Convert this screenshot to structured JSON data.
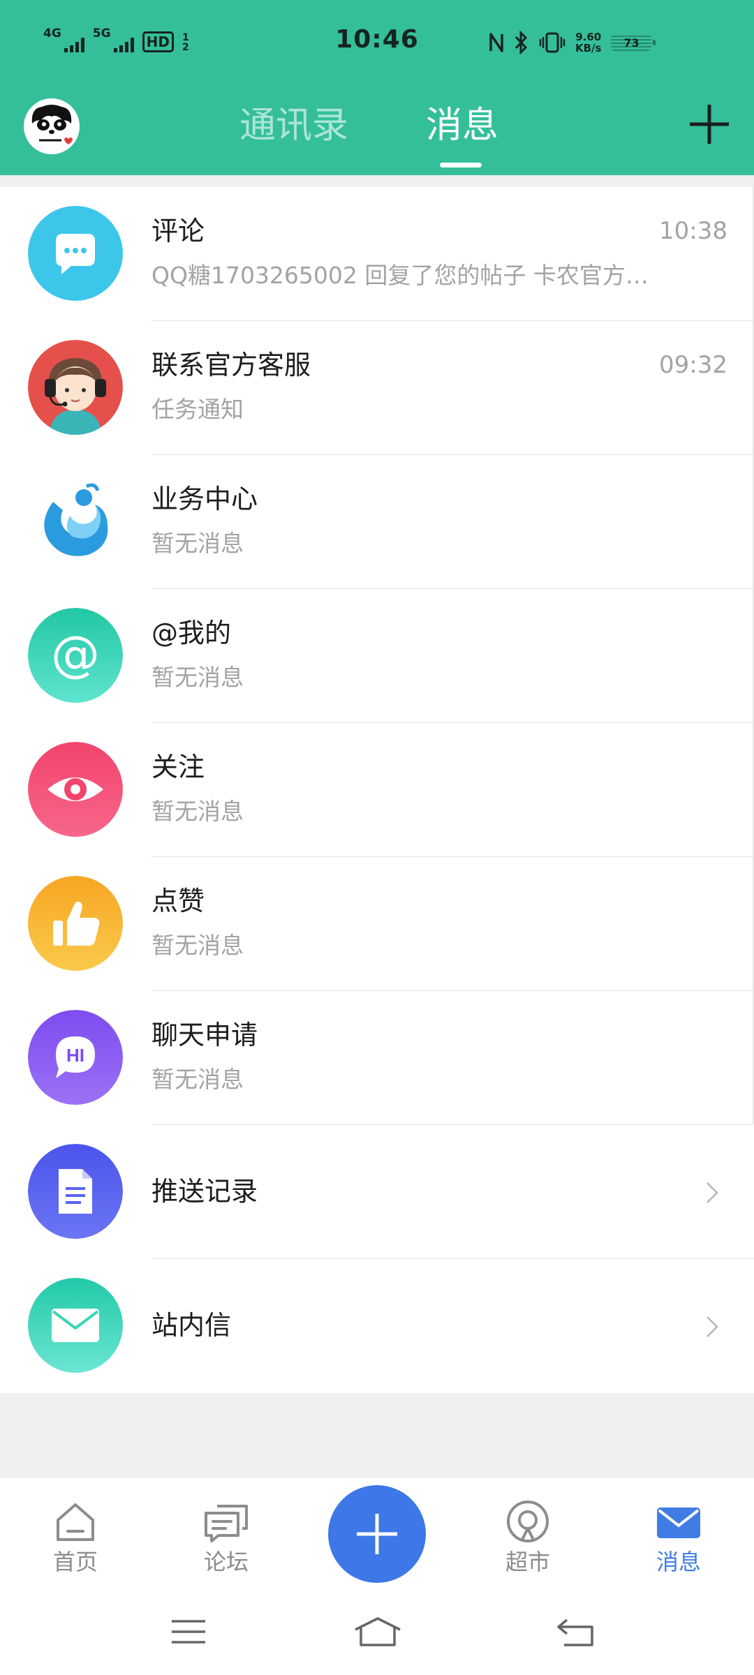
{
  "status_bar": {
    "time": "10:46",
    "net1": "4G",
    "net2": "5G",
    "hd": "HD",
    "hd_sub": "1 2",
    "speed_value": "9.60",
    "speed_unit": "KB/s",
    "battery": "73"
  },
  "header": {
    "tab_contacts": "通讯录",
    "tab_messages": "消息",
    "active_tab": "消息",
    "accent_color": "#34bf9a"
  },
  "messages": [
    {
      "title": "评论",
      "subtitle": "QQ糖1703265002 回复了您的帖子 卡农官方…",
      "time": "10:38",
      "icon": "comment-bubble-icon",
      "color": "#3cc6ea"
    },
    {
      "title": "联系官方客服",
      "subtitle": "任务通知",
      "time": "09:32",
      "icon": "customer-service-icon",
      "color": "#e5504c"
    },
    {
      "title": "业务中心",
      "subtitle": "暂无消息",
      "time": "",
      "icon": "business-center-icon",
      "color": "#2b9be0"
    },
    {
      "title": "@我的",
      "subtitle": "暂无消息",
      "time": "",
      "icon": "at-mention-icon",
      "color": "#2ed3b0"
    },
    {
      "title": "关注",
      "subtitle": "暂无消息",
      "time": "",
      "icon": "eye-icon",
      "color": "#f2446c"
    },
    {
      "title": "点赞",
      "subtitle": "暂无消息",
      "time": "",
      "icon": "thumbs-up-icon",
      "color": "#f8b12c"
    },
    {
      "title": "聊天申请",
      "subtitle": "暂无消息",
      "time": "",
      "icon": "chat-request-icon",
      "color": "#8a5cf0"
    },
    {
      "title": "推送记录",
      "subtitle": "",
      "time": "",
      "icon": "document-icon",
      "color": "#5b63ef"
    },
    {
      "title": "站内信",
      "subtitle": "",
      "time": "",
      "icon": "envelope-icon",
      "color": "#3bd5b6"
    }
  ],
  "chat_request_icon_text": "HI",
  "bottom_nav": {
    "home": "首页",
    "forum": "论坛",
    "market": "超市",
    "messages": "消息",
    "active": "消息",
    "active_color": "#3f7de4"
  }
}
